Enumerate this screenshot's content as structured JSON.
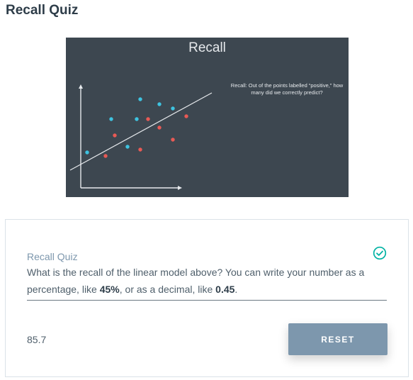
{
  "page": {
    "title": "Recall Quiz"
  },
  "slide": {
    "title": "Recall",
    "caption": "Recall: Out of the points labelled “positive,” how many did we correctly predict?",
    "colors": {
      "background": "#3d4750",
      "positive": "#3ec3e0",
      "negative": "#e85a55",
      "axis": "#e6e9ec"
    }
  },
  "quiz": {
    "label": "Recall Quiz",
    "question_prefix": "What is the recall of the linear model above? You can write your number as a percentage, like ",
    "example_percent": "45%",
    "question_middle": ", or as a decimal, like ",
    "example_decimal": "0.45",
    "question_suffix": ".",
    "answer": "85.7",
    "reset_label": "RESET",
    "status_icon": "check-circle-icon",
    "colors": {
      "accent": "#7d97ad",
      "success": "#02b3a4"
    }
  }
}
